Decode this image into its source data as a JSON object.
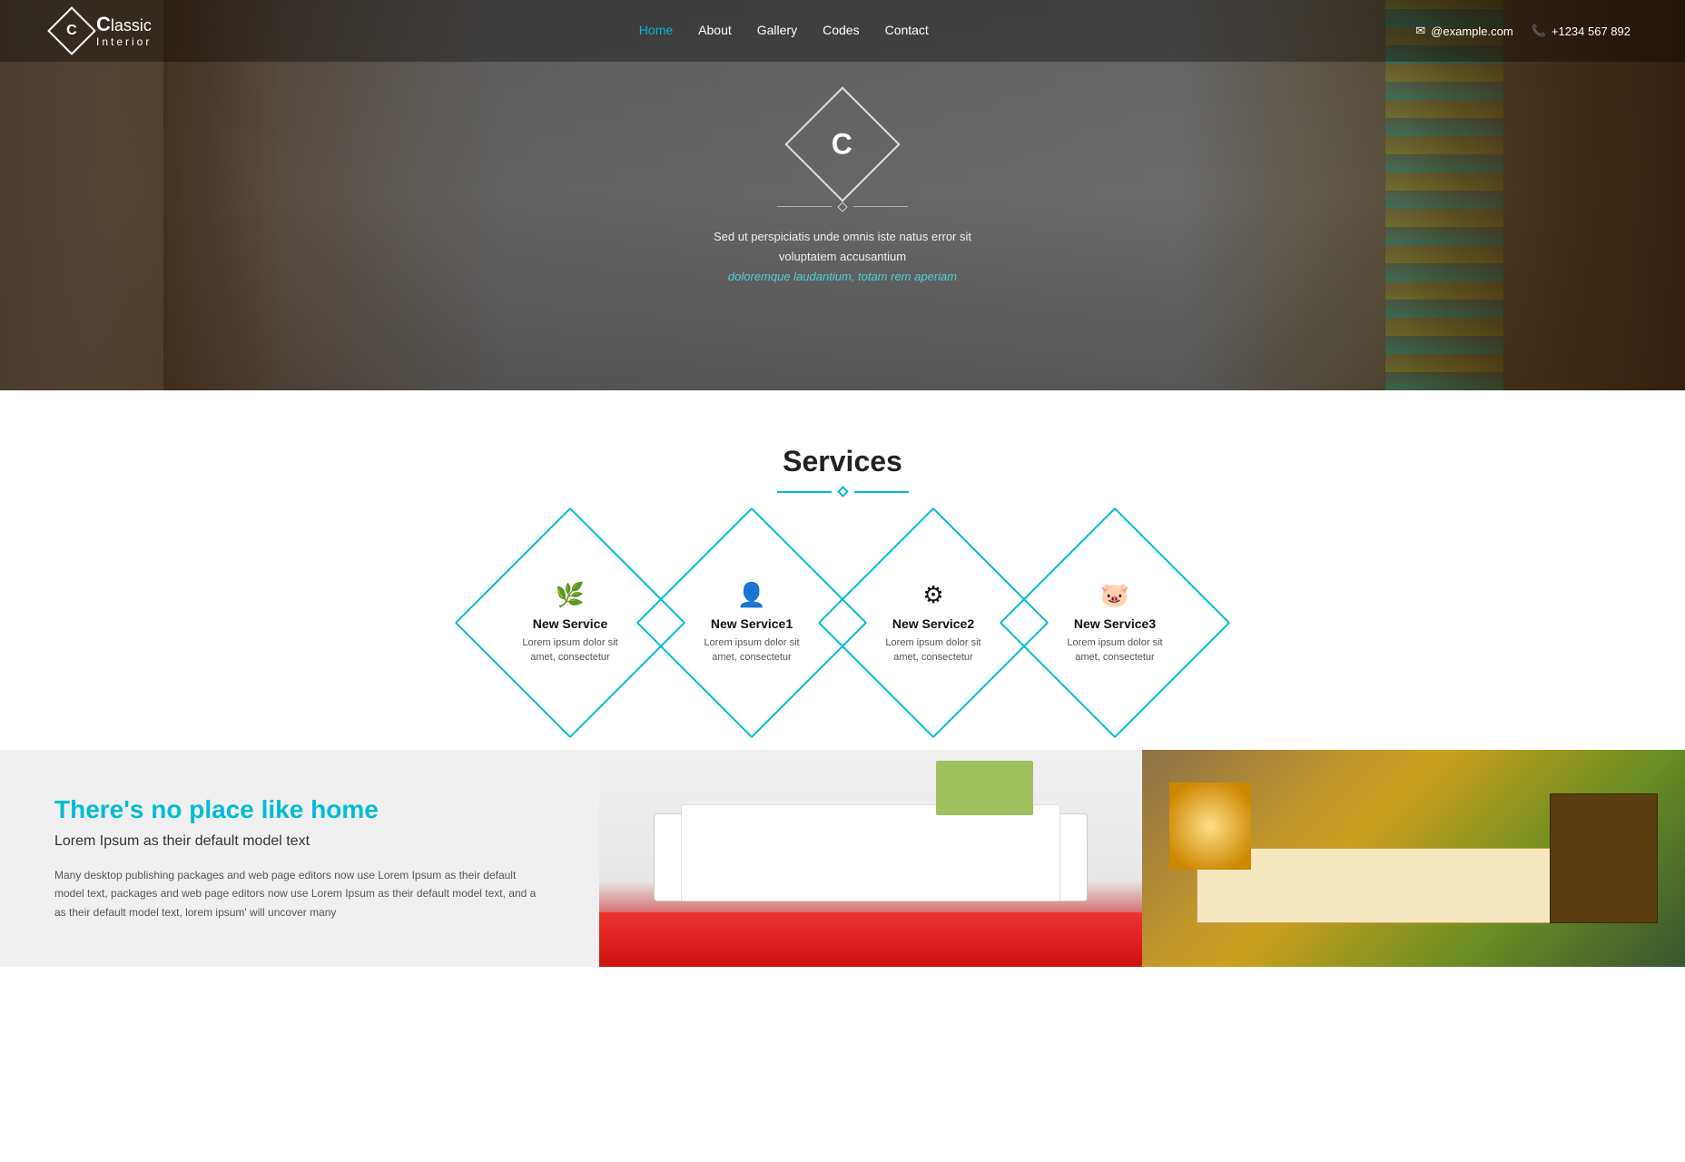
{
  "navbar": {
    "logo_letter": "C",
    "logo_classic": "lassic",
    "logo_interior": "Interior",
    "nav_items": [
      {
        "label": "Home",
        "active": true
      },
      {
        "label": "About",
        "active": false
      },
      {
        "label": "Gallery",
        "active": false
      },
      {
        "label": "Codes",
        "active": false
      },
      {
        "label": "Contact",
        "active": false
      }
    ],
    "email_icon": "✉",
    "email": "@example.com",
    "phone_icon": "📞",
    "phone": "+1234 567 892"
  },
  "hero": {
    "logo_letter": "C",
    "subtitle_line1": "Sed ut perspiciatis unde omnis iste natus error sit voluptatem accusantium",
    "subtitle_line2": "doloremque laudantium, totam rem aperiam"
  },
  "services": {
    "title": "Services",
    "items": [
      {
        "icon": "🌿",
        "name": "New Service",
        "desc": "Lorem ipsum dolor sit amet, consectetur"
      },
      {
        "icon": "👤",
        "name": "New Service1",
        "desc": "Lorem ipsum dolor sit amet, consectetur"
      },
      {
        "icon": "⚙",
        "name": "New Service2",
        "desc": "Lorem ipsum dolor sit amet, consectetur"
      },
      {
        "icon": "🐷",
        "name": "New Service3",
        "desc": "Lorem ipsum dolor sit amet, consectetur"
      }
    ]
  },
  "bottom": {
    "heading": "There's no place like home",
    "subheading": "Lorem Ipsum as their default model text",
    "body": "Many desktop publishing packages and web page editors now use Lorem Ipsum as their default model text, packages and web page editors now use Lorem Ipsum as their default model text, and a as their default model text, lorem ipsum' will uncover many"
  }
}
